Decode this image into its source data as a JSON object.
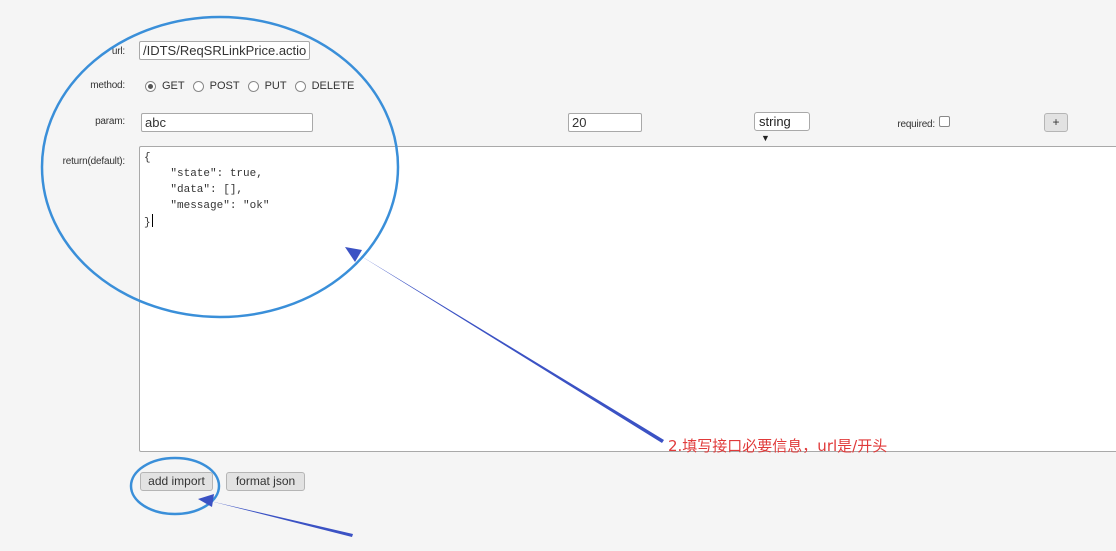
{
  "form": {
    "url_label": "url:",
    "url_value": "/IDTS/ReqSRLinkPrice.actio",
    "method_label": "method:",
    "methods": [
      {
        "label": "GET",
        "checked": true
      },
      {
        "label": "POST",
        "checked": false
      },
      {
        "label": "PUT",
        "checked": false
      },
      {
        "label": "DELETE",
        "checked": false
      }
    ],
    "param_label": "param:",
    "param_name_value": "abc",
    "param_length_value": "20",
    "param_type_value": "string",
    "param_type_arrow": "▼",
    "required_label": "required:",
    "required_checked": false,
    "add_param_label": "+",
    "return_label": "return(default):",
    "return_lines": [
      "{",
      "    \"state\": true,",
      "    \"data\": [],",
      "    \"message\": \"ok\"",
      "}"
    ],
    "add_import_label": "add import",
    "format_json_label": "format json"
  },
  "annotation": {
    "text": "2.填写接口必要信息，url是/开头",
    "color": "#e03a3a"
  },
  "markup_colors": {
    "circle": "#3a8fd9",
    "arrow": "#3b52c4"
  }
}
